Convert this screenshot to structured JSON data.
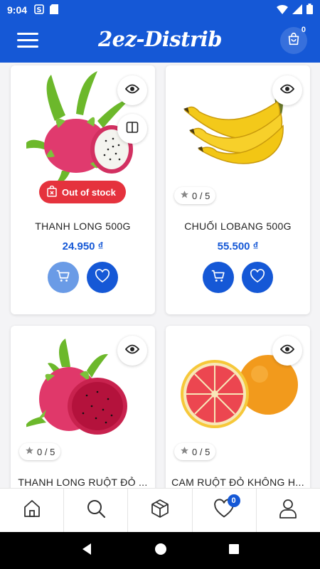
{
  "status_bar": {
    "time": "9:04"
  },
  "app_bar": {
    "title": "2ez-Distrib",
    "cart_count": "0"
  },
  "products": [
    {
      "name": "THANH LONG 500G",
      "price": "24.950 ₫",
      "stock_label": "Out of stock"
    },
    {
      "name": "CHUỐI LOBANG 500G",
      "price": "55.500 ₫",
      "rating": "0 / 5"
    },
    {
      "name": "THANH LONG RUỘT ĐỎ ...",
      "rating": "0 / 5"
    },
    {
      "name": "CAM RUỘT ĐỎ KHÔNG H...",
      "rating": "0 / 5"
    }
  ],
  "bottom_nav": {
    "favorites_count": "0"
  },
  "colors": {
    "primary": "#1558d6",
    "out_of_stock": "#e5323d",
    "disabled_cart": "#6a9be6"
  }
}
